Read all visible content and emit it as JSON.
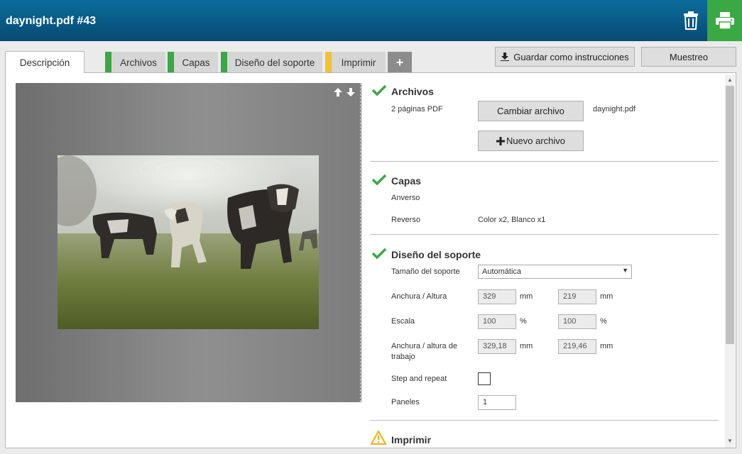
{
  "header": {
    "title": "daynight.pdf #43",
    "icons": {
      "delete": "trash-icon",
      "print": "printer-icon"
    }
  },
  "tabs": [
    {
      "label": "Descripción"
    },
    {
      "label": "Archivos"
    },
    {
      "label": "Capas"
    },
    {
      "label": "Diseño del soporte"
    },
    {
      "label": "Imprimir"
    },
    {
      "label": "+"
    }
  ],
  "toolbar": {
    "save_label": "Guardar como instrucciones",
    "sample_label": "Muestreo"
  },
  "sections": {
    "files": {
      "title": "Archivos",
      "pages": "2 páginas PDF",
      "change_label": "Cambiar archivo",
      "filename": "daynight.pdf",
      "new_label": "Nuevo archivo"
    },
    "layers": {
      "title": "Capas",
      "front_label": "Anverso",
      "back_label": "Reverso",
      "back_value": "Color x2, Blanco x1"
    },
    "media": {
      "title": "Diseño del soporte",
      "size_label": "Tamaño del soporte",
      "size_value": "Automática",
      "wh_label": "Anchura / Altura",
      "width": "329",
      "height": "219",
      "unit_mm": "mm",
      "scale_label": "Escala",
      "scale_x": "100",
      "scale_y": "100",
      "unit_pct": "%",
      "work_label_1": "Anchura / altura de",
      "work_label_2": "trabajo",
      "work_width": "329,18",
      "work_height": "219,46",
      "step_label": "Step and repeat",
      "panels_label": "Paneles",
      "panels_value": "1"
    },
    "print": {
      "title": "Imprimir"
    }
  },
  "colors": {
    "header": "#0b6c9c",
    "green": "#3aa843",
    "yellow": "#f2c230",
    "warning": "#f0b323"
  }
}
